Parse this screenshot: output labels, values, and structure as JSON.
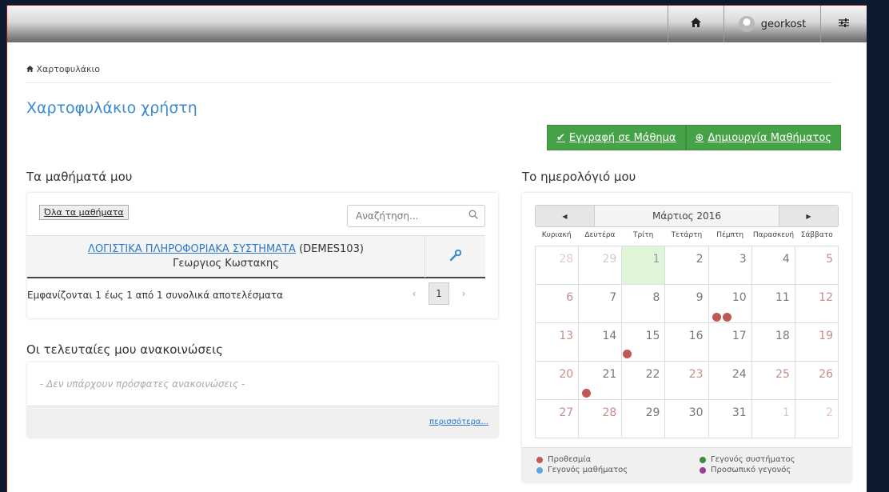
{
  "topbar": {
    "home_icon": "home-icon",
    "username": "georkost",
    "settings_icon": "sliders-icon"
  },
  "breadcrumb": {
    "label": "Χαρτοφυλάκιο"
  },
  "page_title": "Χαρτοφυλάκιο χρήστη",
  "actions": {
    "enroll_label": "Εγγραφή σε Μάθημα",
    "create_label": "Δημιουργία Μαθήματος"
  },
  "courses": {
    "title": "Τα μαθήματά μου",
    "all_button": "Όλα τα μαθήματα",
    "search_placeholder": "Αναζήτηση...",
    "rows": [
      {
        "name": "ΛΟΓΙΣΤΙΚΑ ΠΛΗΡΟΦΟΡΙΑΚΑ ΣΥΣΤΗΜΑΤΑ",
        "code": "(DEMES103)",
        "teacher": "Γεωργιος Κωστακης"
      }
    ],
    "results_info": "Εμφανίζονται 1 έως 1 από 1 συνολικά αποτελέσματα",
    "pager": {
      "prev": "‹",
      "page": "1",
      "next": "›"
    }
  },
  "announcements": {
    "title": "Οι τελευταίες μου ανακοινώσεις",
    "empty": "- Δεν υπάρχουν πρόσφατες ανακοινώσεις -",
    "more": "περισσότερα..."
  },
  "calendar": {
    "title": "Το ημερολόγιό μου",
    "month": "Μάρτιος 2016",
    "prev": "◀",
    "next": "▶",
    "weekdays": [
      "Κυριακή",
      "Δευτέρα",
      "Τρίτη",
      "Τετάρτη",
      "Πέμπτη",
      "Παρασκευή",
      "Σάββατο"
    ],
    "weeks": [
      [
        "28",
        "29",
        "1",
        "2",
        "3",
        "4",
        "5"
      ],
      [
        "6",
        "7",
        "8",
        "9",
        "10",
        "11",
        "12"
      ],
      [
        "13",
        "14",
        "15",
        "16",
        "17",
        "18",
        "19"
      ],
      [
        "20",
        "21",
        "22",
        "23",
        "24",
        "25",
        "26"
      ],
      [
        "27",
        "28",
        "29",
        "30",
        "31",
        "1",
        "2"
      ]
    ],
    "legend": {
      "deadline": "Προθεσμία",
      "course_event": "Γεγονός μαθήματος",
      "system_event": "Γεγονός συστήματος",
      "personal_event": "Προσωπικό γεγονός"
    },
    "colors": {
      "deadline": "#c05858",
      "course_event": "#5aa6e6",
      "system_event": "#3f8a3f",
      "personal_event": "#9a3b9a"
    }
  }
}
